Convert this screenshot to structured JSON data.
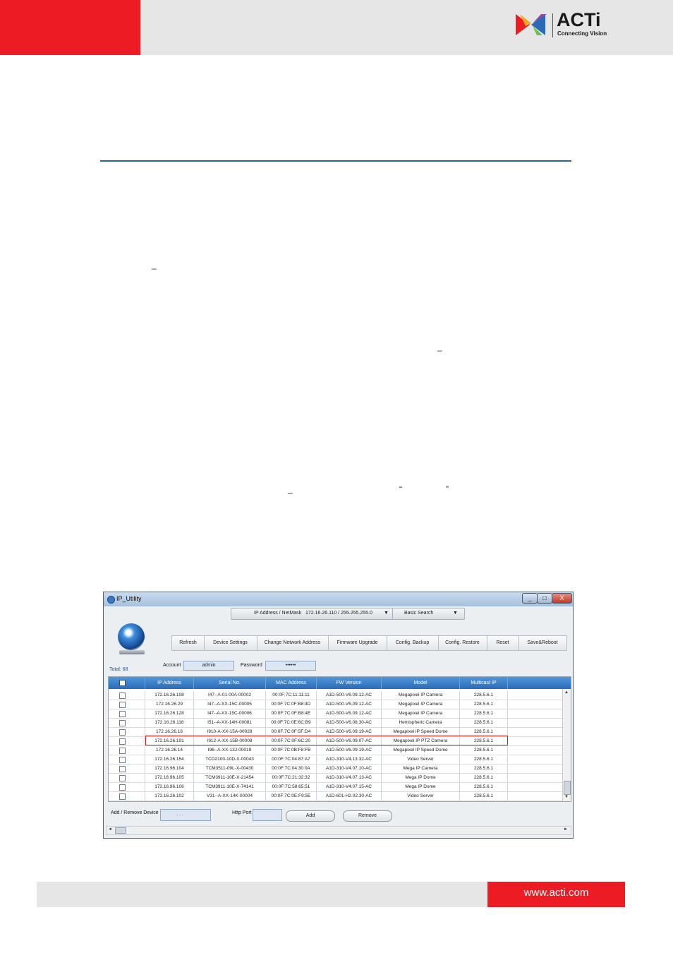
{
  "header": {
    "brand": "ACTi",
    "tagline": "Connecting Vision",
    "colors": {
      "red": "#ed1c24",
      "gray": "#e6e6e6",
      "rule": "#2e5f97"
    }
  },
  "marks": {
    "underscore": "_",
    "open_quote": "“",
    "close_quote": "”"
  },
  "app": {
    "title": "IP_Utility",
    "window_controls": {
      "minimize": "_",
      "maximize": "□",
      "close": "X"
    },
    "ip_bar": {
      "label": "IP Address / NetMask",
      "value": "172.16.26.110 / 255.255.255.0",
      "search": "Basic Search",
      "dropdown_icon": "▼"
    },
    "toolbar": [
      "Refresh",
      "Device Settings",
      "Change Network Address",
      "Firmware Upgrade",
      "Config. Backup",
      "Config. Restore",
      "Reset",
      "Save&Reboot"
    ],
    "account_label": "Account",
    "account_value": "admin",
    "password_label": "Password",
    "password_value": "••••••",
    "total": "Total: 68",
    "columns": [
      "IP Address",
      "Serial No.",
      "MAC Address",
      "FW Version",
      "Model",
      "Multicast IP"
    ],
    "rows": [
      [
        "172.16.26.108",
        "I47--A-01-00A-00002",
        "00:0F:7C:11:11:11",
        "A1D-500-V6.09.12-AC",
        "Megapixel IP Camera",
        "228.5.6.1"
      ],
      [
        "172.16.26.29",
        "I47--A-XX-15C-00005",
        "00:0F:7C:0F:B8:4D",
        "A1D-500-V6.09.12-AC",
        "Megapixel IP Camera",
        "228.5.6.1"
      ],
      [
        "172.16.26.128",
        "I47--A-XX-15C-00006",
        "00:0F:7C:0F:B8:4E",
        "A1D-500-V6.09.12-AC",
        "Megapixel IP Camera",
        "228.5.6.1"
      ],
      [
        "172.16.26.118",
        "I51--A-XX-14H-00081",
        "00:0F:7C:0E:6C:B9",
        "A1D-500-V6.08.30-AC",
        "Hemispheric Camera",
        "228.5.6.1"
      ],
      [
        "172.16.26.16",
        "I910-A-XX-15A-00028",
        "00:0F:7C:0F:5F:D4",
        "A1D-500-V6.09.19-AC",
        "Megapixel IP Speed Dome",
        "228.5.6.1"
      ],
      [
        "172.16.26.191",
        "I912-A-XX-15B-00008",
        "00:0F:7C:0F:6C:20",
        "A1D-500-V6.09.07-AC",
        "Megapixel IP PTZ Camera",
        "228.5.6.1"
      ],
      [
        "172.16.26.14",
        "I96--A-XX-13J-00019",
        "00:0F:7C:0B:F8:FB",
        "A1D-500-V6.09.19-AC",
        "Megapixel IP Speed Dome",
        "228.5.6.1"
      ],
      [
        "172.16.26.154",
        "TCD2100-10D-X-00043",
        "00:0F:7C:04:87:A7",
        "A1D-310-V4.13.32-AC",
        "Video Server",
        "228.5.6.1"
      ],
      [
        "172.16.96.104",
        "TCM3511-09L-X-00430",
        "00:0F:7C:04:30:0A",
        "A1D-310-V4.07.10-AC",
        "Mega IP Camera",
        "228.5.6.1"
      ],
      [
        "172.16.96.105",
        "TCM3911-10E-X-21454",
        "00:0F:7C:21:32:32",
        "A1D-310-V4.07.13-AC",
        "Mega IP Dome",
        "228.5.6.1"
      ],
      [
        "172.16.96.106",
        "TCM3911-10E-X-74141",
        "00:0F:7C:58:65:51",
        "A1D-310-V4.07.15-AC",
        "Mega IP Dome",
        "228.5.6.1"
      ],
      [
        "172.16.26.102",
        "V31--A-XX-14K-00004",
        "00:0F:7C:0E:F9:5E",
        "A1D-601-H2.02.30-AC",
        "Video Server",
        "228.5.6.1"
      ]
    ],
    "add_label": "Add / Remove Device",
    "ip_placeholder": ".   .   .",
    "port_label": "Http Port",
    "add_button": "Add",
    "remove_button": "Remove",
    "scroll_up": "▲",
    "scroll_down": "▼",
    "scroll_left": "◄",
    "scroll_right": "►"
  },
  "footer": {
    "url": "www.acti.com"
  }
}
